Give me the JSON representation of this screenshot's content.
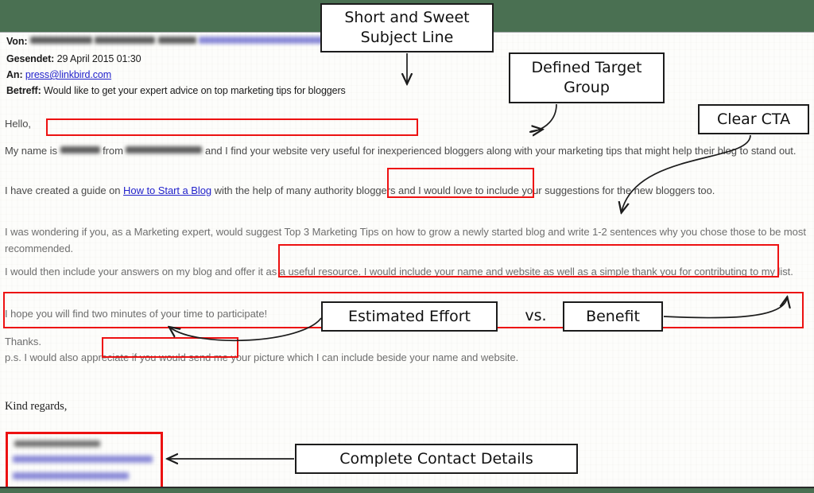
{
  "theme": {
    "background": "#4a7052",
    "page": "#fdfdfb",
    "highlight": "#ee1111",
    "link": "#2222cc",
    "body_text": "#6e6e6e",
    "header_text": "#1a1a1a",
    "note_border": "#1c1c1c"
  },
  "email": {
    "header": {
      "from_label": "Von:",
      "from_value": "",
      "sent_label": "Gesendet:",
      "sent_value": "29 April 2015 01:30",
      "to_label": "An:",
      "to_value": "press@linkbird.com",
      "subject_label": "Betreff:",
      "subject_value": "Would like to get your expert advice on top marketing tips for bloggers"
    },
    "body": {
      "greeting": "Hello,",
      "intro_prefix": "My name is",
      "intro_mid": "from",
      "intro_suffix": "and I find your website very useful for inexperienced bloggers along with your marketing tips that might help their blog to stand out.",
      "guide_before": "I have created a guide on",
      "guide_link": "How to Start a Blog",
      "guide_after": "with the help of many authority bloggers and I would love to include your suggestions for the new bloggers too.",
      "ask": "I was wondering if you, as a Marketing expert, would suggest Top 3 Marketing Tips on how to grow a newly started blog and write 1-2 sentences why you chose those to be most recommended.",
      "offer": "I would then include your answers on my blog and offer it as a useful resource. I would include your name and website as well as a simple thank you for contributing to my list.",
      "effort": "I hope you will find two minutes of your time to participate!",
      "thanks": "Thanks.",
      "ps": "p.s. I would also appreciate if you would send me your picture which I can include beside your name and website.",
      "regards": "Kind regards,"
    },
    "signature": {
      "name_redacted": "",
      "email_redacted": "",
      "website_redacted": ""
    }
  },
  "annotations": {
    "subject": {
      "line1": "Short and Sweet",
      "line2": "Subject Line"
    },
    "target": {
      "line1": "Defined Target",
      "line2": "Group"
    },
    "cta": {
      "line1": "Clear CTA",
      "line2": ""
    },
    "effort": {
      "line1": "Estimated Effort",
      "line2": ""
    },
    "vs": {
      "label": "vs."
    },
    "benefit": {
      "line1": "Benefit",
      "line2": ""
    },
    "contact": {
      "line1": "Complete Contact Details",
      "line2": ""
    }
  },
  "highlights": [
    {
      "name": "subject-line",
      "text": "Would like to get your expert advice on top marketing tips for bloggers"
    },
    {
      "name": "target-group",
      "text": "for inexperienced bloggers"
    },
    {
      "name": "clear-cta",
      "text": "suggest Top 3 Marketing Tips on how to grow a newly started blog and write 1-2 sentences why you"
    },
    {
      "name": "benefit",
      "text": "I would then include your answers on my blog and offer it as a useful resource. I would include your name and website as well as a simple thank you for contributing to my list."
    },
    {
      "name": "estimated-effort",
      "text": "two minutes of your time"
    },
    {
      "name": "contact-details",
      "text": ""
    }
  ]
}
